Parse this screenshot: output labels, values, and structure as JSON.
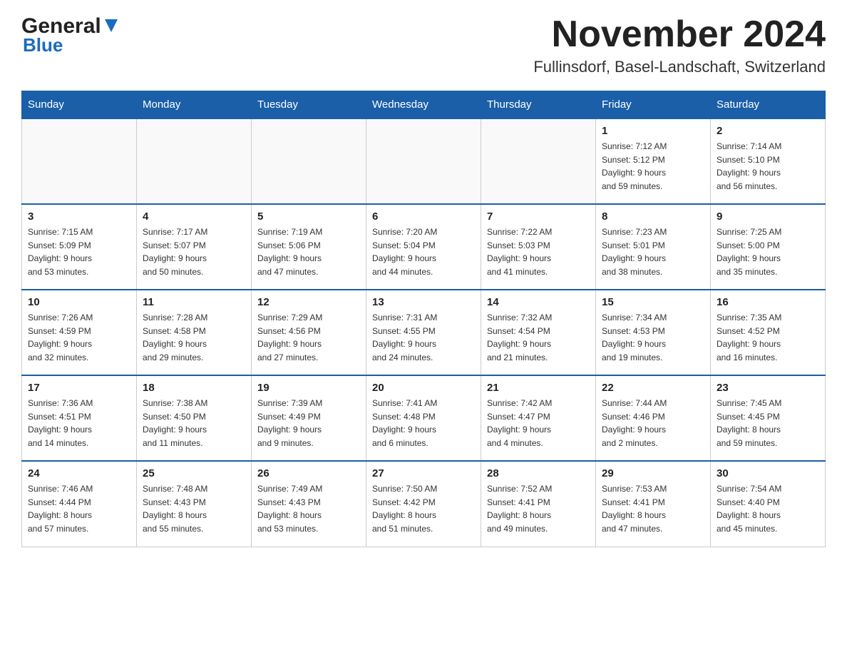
{
  "logo": {
    "part1": "General",
    "part2": "Blue"
  },
  "header": {
    "title": "November 2024",
    "subtitle": "Fullinsdorf, Basel-Landschaft, Switzerland"
  },
  "weekdays": [
    "Sunday",
    "Monday",
    "Tuesday",
    "Wednesday",
    "Thursday",
    "Friday",
    "Saturday"
  ],
  "rows": [
    [
      {
        "day": "",
        "info": ""
      },
      {
        "day": "",
        "info": ""
      },
      {
        "day": "",
        "info": ""
      },
      {
        "day": "",
        "info": ""
      },
      {
        "day": "",
        "info": ""
      },
      {
        "day": "1",
        "info": "Sunrise: 7:12 AM\nSunset: 5:12 PM\nDaylight: 9 hours\nand 59 minutes."
      },
      {
        "day": "2",
        "info": "Sunrise: 7:14 AM\nSunset: 5:10 PM\nDaylight: 9 hours\nand 56 minutes."
      }
    ],
    [
      {
        "day": "3",
        "info": "Sunrise: 7:15 AM\nSunset: 5:09 PM\nDaylight: 9 hours\nand 53 minutes."
      },
      {
        "day": "4",
        "info": "Sunrise: 7:17 AM\nSunset: 5:07 PM\nDaylight: 9 hours\nand 50 minutes."
      },
      {
        "day": "5",
        "info": "Sunrise: 7:19 AM\nSunset: 5:06 PM\nDaylight: 9 hours\nand 47 minutes."
      },
      {
        "day": "6",
        "info": "Sunrise: 7:20 AM\nSunset: 5:04 PM\nDaylight: 9 hours\nand 44 minutes."
      },
      {
        "day": "7",
        "info": "Sunrise: 7:22 AM\nSunset: 5:03 PM\nDaylight: 9 hours\nand 41 minutes."
      },
      {
        "day": "8",
        "info": "Sunrise: 7:23 AM\nSunset: 5:01 PM\nDaylight: 9 hours\nand 38 minutes."
      },
      {
        "day": "9",
        "info": "Sunrise: 7:25 AM\nSunset: 5:00 PM\nDaylight: 9 hours\nand 35 minutes."
      }
    ],
    [
      {
        "day": "10",
        "info": "Sunrise: 7:26 AM\nSunset: 4:59 PM\nDaylight: 9 hours\nand 32 minutes."
      },
      {
        "day": "11",
        "info": "Sunrise: 7:28 AM\nSunset: 4:58 PM\nDaylight: 9 hours\nand 29 minutes."
      },
      {
        "day": "12",
        "info": "Sunrise: 7:29 AM\nSunset: 4:56 PM\nDaylight: 9 hours\nand 27 minutes."
      },
      {
        "day": "13",
        "info": "Sunrise: 7:31 AM\nSunset: 4:55 PM\nDaylight: 9 hours\nand 24 minutes."
      },
      {
        "day": "14",
        "info": "Sunrise: 7:32 AM\nSunset: 4:54 PM\nDaylight: 9 hours\nand 21 minutes."
      },
      {
        "day": "15",
        "info": "Sunrise: 7:34 AM\nSunset: 4:53 PM\nDaylight: 9 hours\nand 19 minutes."
      },
      {
        "day": "16",
        "info": "Sunrise: 7:35 AM\nSunset: 4:52 PM\nDaylight: 9 hours\nand 16 minutes."
      }
    ],
    [
      {
        "day": "17",
        "info": "Sunrise: 7:36 AM\nSunset: 4:51 PM\nDaylight: 9 hours\nand 14 minutes."
      },
      {
        "day": "18",
        "info": "Sunrise: 7:38 AM\nSunset: 4:50 PM\nDaylight: 9 hours\nand 11 minutes."
      },
      {
        "day": "19",
        "info": "Sunrise: 7:39 AM\nSunset: 4:49 PM\nDaylight: 9 hours\nand 9 minutes."
      },
      {
        "day": "20",
        "info": "Sunrise: 7:41 AM\nSunset: 4:48 PM\nDaylight: 9 hours\nand 6 minutes."
      },
      {
        "day": "21",
        "info": "Sunrise: 7:42 AM\nSunset: 4:47 PM\nDaylight: 9 hours\nand 4 minutes."
      },
      {
        "day": "22",
        "info": "Sunrise: 7:44 AM\nSunset: 4:46 PM\nDaylight: 9 hours\nand 2 minutes."
      },
      {
        "day": "23",
        "info": "Sunrise: 7:45 AM\nSunset: 4:45 PM\nDaylight: 8 hours\nand 59 minutes."
      }
    ],
    [
      {
        "day": "24",
        "info": "Sunrise: 7:46 AM\nSunset: 4:44 PM\nDaylight: 8 hours\nand 57 minutes."
      },
      {
        "day": "25",
        "info": "Sunrise: 7:48 AM\nSunset: 4:43 PM\nDaylight: 8 hours\nand 55 minutes."
      },
      {
        "day": "26",
        "info": "Sunrise: 7:49 AM\nSunset: 4:43 PM\nDaylight: 8 hours\nand 53 minutes."
      },
      {
        "day": "27",
        "info": "Sunrise: 7:50 AM\nSunset: 4:42 PM\nDaylight: 8 hours\nand 51 minutes."
      },
      {
        "day": "28",
        "info": "Sunrise: 7:52 AM\nSunset: 4:41 PM\nDaylight: 8 hours\nand 49 minutes."
      },
      {
        "day": "29",
        "info": "Sunrise: 7:53 AM\nSunset: 4:41 PM\nDaylight: 8 hours\nand 47 minutes."
      },
      {
        "day": "30",
        "info": "Sunrise: 7:54 AM\nSunset: 4:40 PM\nDaylight: 8 hours\nand 45 minutes."
      }
    ]
  ]
}
